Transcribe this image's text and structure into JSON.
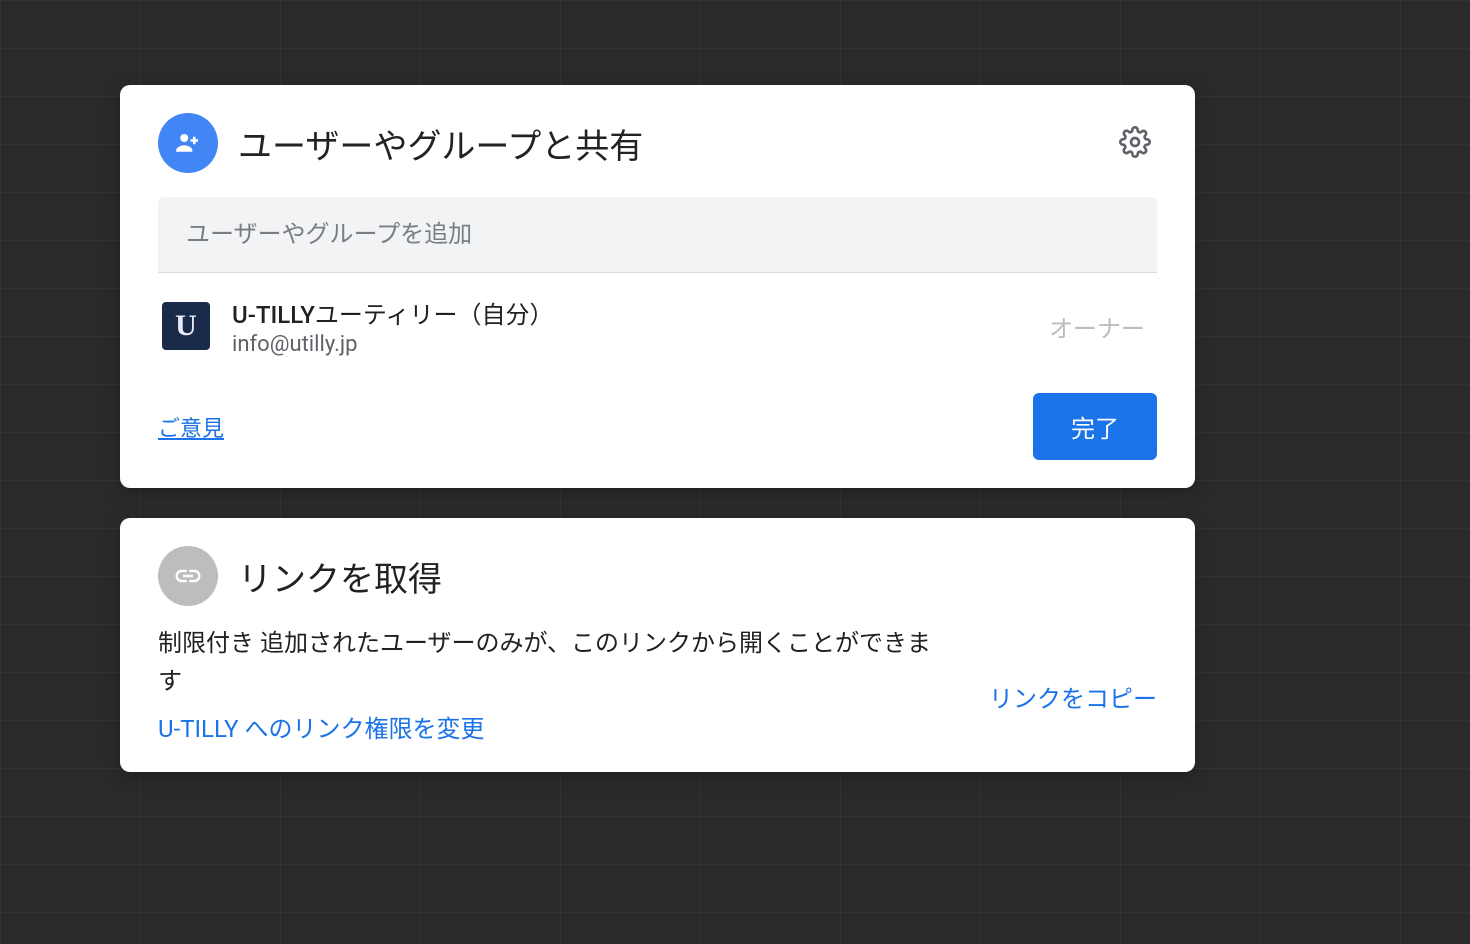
{
  "share": {
    "title": "ユーザーやグループと共有",
    "input_placeholder": "ユーザーやグループを追加",
    "user": {
      "avatar_letter": "U",
      "name": "U-TILLYユーティリー（自分）",
      "email": "info@utilly.jp",
      "role": "オーナー"
    },
    "feedback_label": "ご意見",
    "done_label": "完了"
  },
  "link": {
    "title": "リンクを取得",
    "restriction_prefix": "制限付き",
    "restriction_text": " 追加されたユーザーのみが、このリンクから開くことができます",
    "copy_label": "リンクをコピー",
    "change_label": "U-TILLY へのリンク権限を変更"
  }
}
